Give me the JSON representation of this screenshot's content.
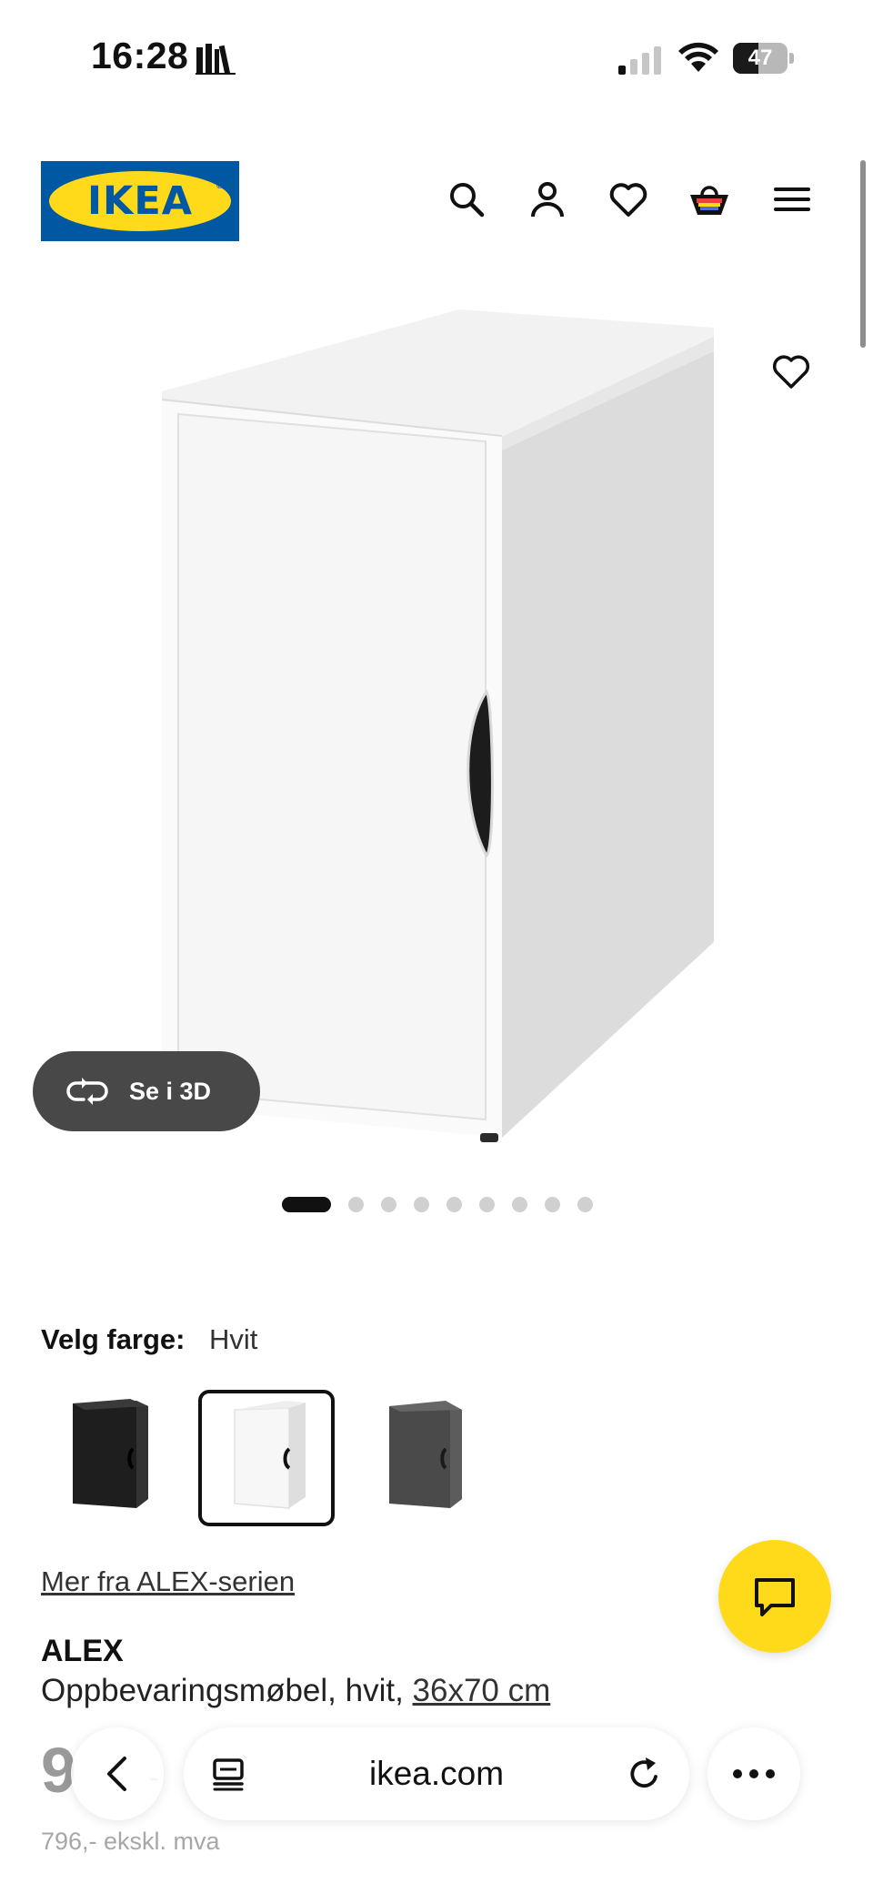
{
  "status_bar": {
    "time": "16:28",
    "battery_percent": "47",
    "icons": [
      "books-icon",
      "signal-icon",
      "wifi-icon",
      "battery-icon"
    ]
  },
  "header": {
    "logo_text": "IKEA",
    "icons": [
      "search-icon",
      "user-icon",
      "heart-icon",
      "basket-icon",
      "menu-icon"
    ],
    "brand_blue": "#0058a3",
    "brand_yellow": "#ffda1a"
  },
  "gallery": {
    "see_3d_label": "Se i 3D",
    "image_count": 9,
    "active_index": 0
  },
  "color_picker": {
    "label": "Velg farge:",
    "selected_value": "Hvit",
    "options": [
      {
        "name": "Svart",
        "color": "#2a2a2a",
        "selected": false
      },
      {
        "name": "Hvit",
        "color": "#f4f4f4",
        "selected": true
      },
      {
        "name": "Grå",
        "color": "#4a4a4a",
        "selected": false
      }
    ]
  },
  "product": {
    "series_link": "Mer fra ALEX-serien",
    "name": "ALEX",
    "description": "Oppbevaringsmøbel, hvit,",
    "size_link": "36x70 cm",
    "price_partial": "9",
    "price_partial_suffix": "-",
    "price_excl_vat": "796,- ekskl. mva"
  },
  "browser": {
    "url": "ikea.com"
  }
}
